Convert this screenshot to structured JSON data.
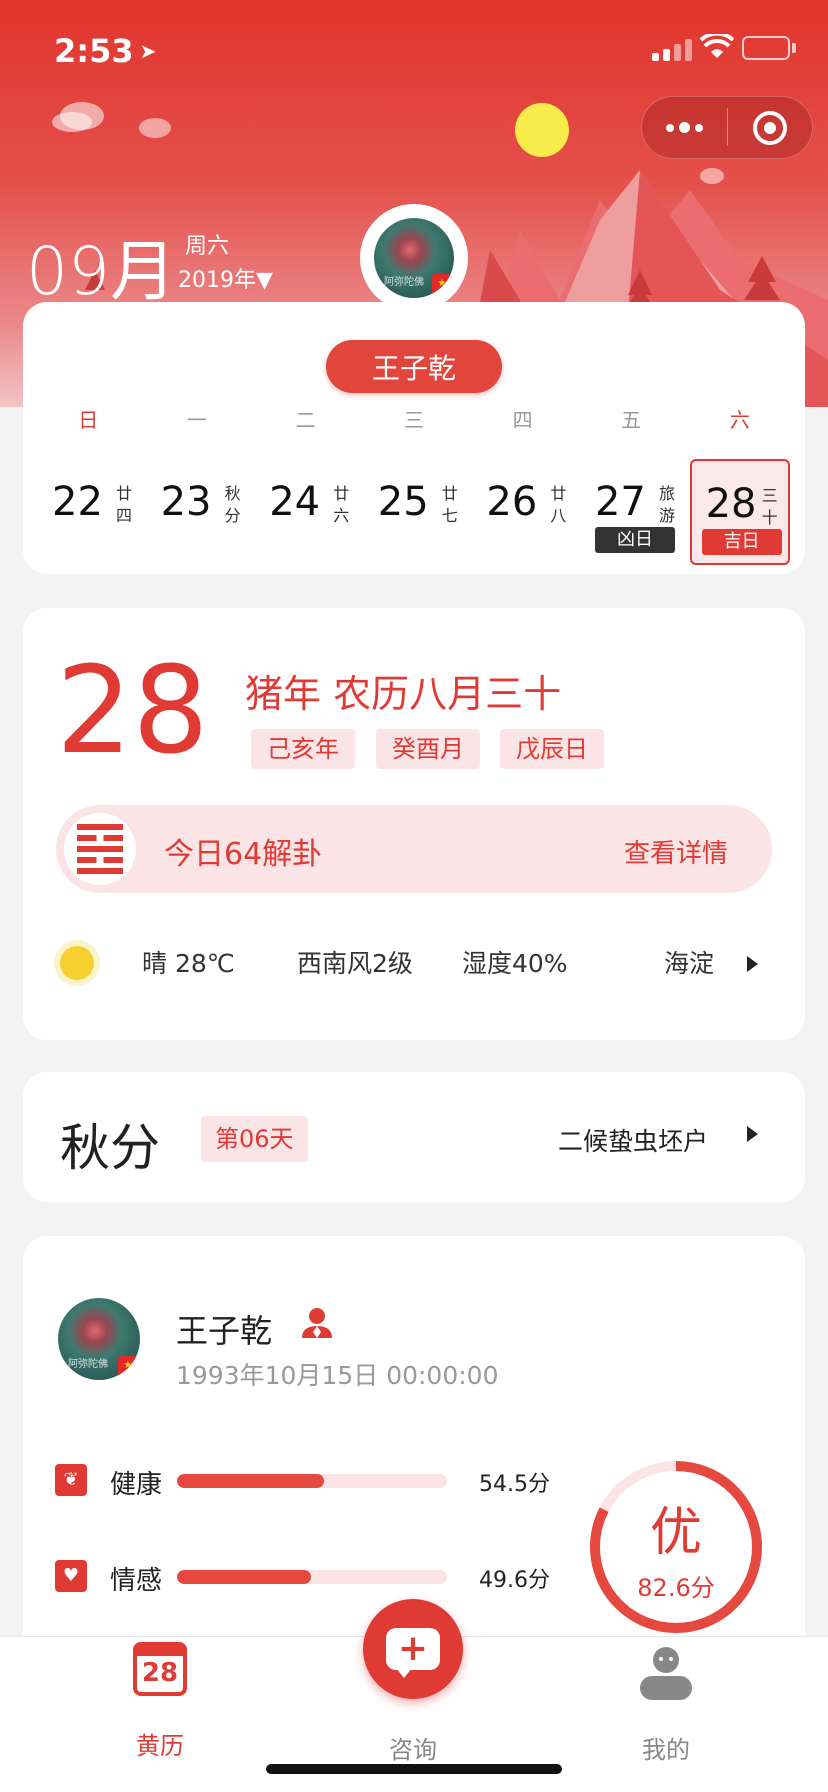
{
  "status": {
    "time": "2:53"
  },
  "header": {
    "month": "09月",
    "weekday": "周六",
    "year": "2019年▼"
  },
  "calendar": {
    "user_name": "王子乾",
    "weekdays": [
      "日",
      "一",
      "二",
      "三",
      "四",
      "五",
      "六"
    ],
    "days": [
      {
        "num": "22",
        "lunar": "廿四",
        "tag": ""
      },
      {
        "num": "23",
        "lunar": "秋分",
        "tag": ""
      },
      {
        "num": "24",
        "lunar": "廿六",
        "tag": ""
      },
      {
        "num": "25",
        "lunar": "廿七",
        "tag": ""
      },
      {
        "num": "26",
        "lunar": "廿八",
        "tag": ""
      },
      {
        "num": "27",
        "lunar": "旅游",
        "tag": "凶日"
      },
      {
        "num": "28",
        "lunar": "三十",
        "tag": "吉日"
      }
    ]
  },
  "today": {
    "day": "28",
    "lunar_title": "猪年 农历八月三十",
    "ganzhi": [
      "己亥年",
      "癸酉月",
      "戊辰日"
    ],
    "hexagram_text": "今日64解卦",
    "hexagram_link": "查看详情",
    "weather": {
      "condition": "晴 28℃",
      "wind": "西南风2级",
      "humidity": "湿度40%",
      "location": "海淀"
    }
  },
  "solar_term": {
    "name": "秋分",
    "badge": "第06天",
    "phase": "二候蛰虫坯户"
  },
  "profile": {
    "name": "王子乾",
    "birth": "1993年10月15日 00:00:00",
    "avatar_watermark": "阿弥陀佛",
    "metrics": [
      {
        "label": "健康",
        "score": "54.5分",
        "value": 54.5
      },
      {
        "label": "情感",
        "score": "49.6分",
        "value": 49.6
      }
    ],
    "grade": "优",
    "total": "82.6分",
    "total_value": 82.6
  },
  "tabbar": {
    "calendar_num": "28",
    "calendar": "黄历",
    "consult": "咨询",
    "mine": "我的"
  },
  "colors": {
    "accent": "#e03a35",
    "pink": "#fbe4e6"
  }
}
